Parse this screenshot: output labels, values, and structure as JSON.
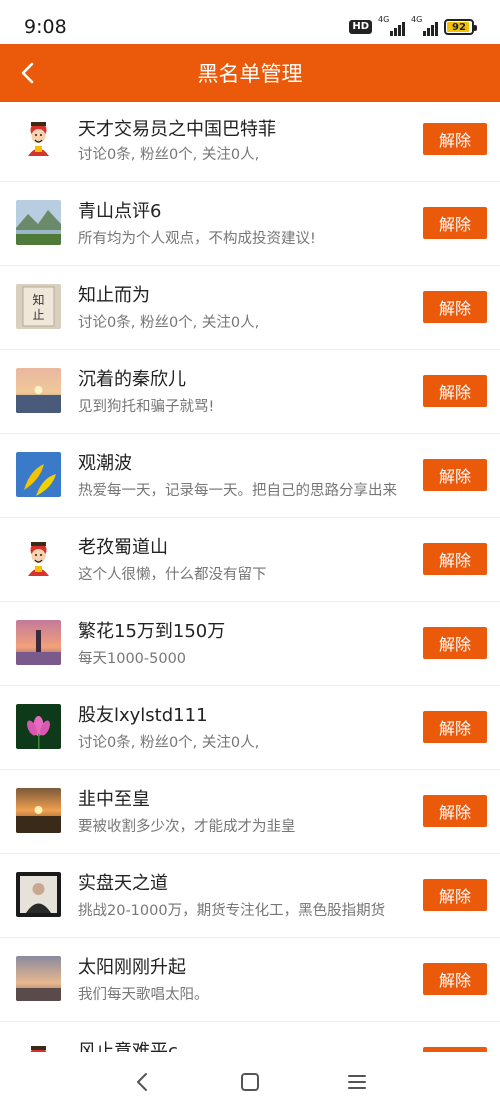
{
  "status_bar": {
    "time": "9:08",
    "hd": "HD",
    "network_1": "4G",
    "network_2": "4G",
    "battery_percent": "92",
    "battery_level": 0.92
  },
  "header": {
    "title": "黑名单管理",
    "back_icon": "chevron-left-icon",
    "bg_color": "#eb5a0b"
  },
  "blacklist": [
    {
      "name": "天才交易员之中国巴特菲",
      "desc": "讨论0条, 粉丝0个, 关注0人,",
      "avatar": "fortune-god"
    },
    {
      "name": "青山点评6",
      "desc": "所有均为个人观点，不构成投资建议!",
      "avatar": "mountain-landscape"
    },
    {
      "name": "知止而为",
      "desc": "讨论0条, 粉丝0个, 关注0人,",
      "avatar": "calligraphy"
    },
    {
      "name": "沉着的秦欣儿",
      "desc": "见到狗托和骗子就骂!",
      "avatar": "sunset-water"
    },
    {
      "name": "观潮波",
      "desc": "热爱每一天，记录每一天。把自己的思路分享出来",
      "avatar": "ginkgo-leaves"
    },
    {
      "name": "老孜蜀道山",
      "desc": "这个人很懒，什么都没有留下",
      "avatar": "fortune-god"
    },
    {
      "name": "繁花15万到150万",
      "desc": "每天1000-5000",
      "avatar": "lighthouse-sunset"
    },
    {
      "name": "股友lxylstd111",
      "desc": "讨论0条, 粉丝0个, 关注0人,",
      "avatar": "lotus-flower"
    },
    {
      "name": "韭中至皇",
      "desc": "要被收割多少次，才能成才为韭皇",
      "avatar": "sunrise-field"
    },
    {
      "name": "实盘天之道",
      "desc": "挑战20-1000万，期货专注化工，黑色股指期货",
      "avatar": "portrait-photo"
    },
    {
      "name": "太阳刚刚升起",
      "desc": "我们每天歌唱太阳。",
      "avatar": "sunrise-sky"
    },
    {
      "name": "风止意难平c",
      "desc": "",
      "avatar": "fortune-god"
    }
  ],
  "unblock_label": "解除",
  "nav_bar": {
    "back_icon": "back-triangle-icon",
    "home_icon": "home-square-icon",
    "menu_icon": "menu-lines-icon"
  }
}
